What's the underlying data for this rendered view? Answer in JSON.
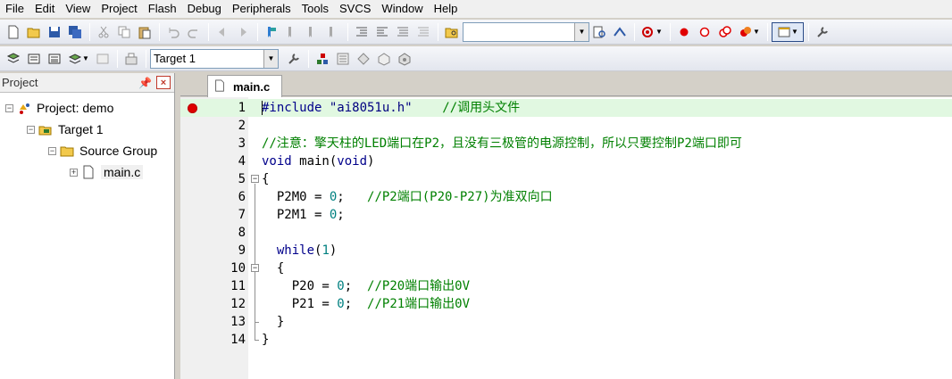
{
  "menu": [
    "File",
    "Edit",
    "View",
    "Project",
    "Flash",
    "Debug",
    "Peripherals",
    "Tools",
    "SVCS",
    "Window",
    "Help"
  ],
  "toolbar2": {
    "target_value": "Target 1"
  },
  "project_panel": {
    "title": "Project",
    "pin_glyph": "📌",
    "close_glyph": "×",
    "tree": {
      "project": "Project: demo",
      "target": "Target 1",
      "group": "Source Group",
      "file": "main.c"
    }
  },
  "editor": {
    "tab_label": "main.c",
    "lines": [
      {
        "n": "1",
        "segments": [
          {
            "t": "#include ",
            "c": "pp"
          },
          {
            "t": "\"ai8051u.h\"",
            "c": "str"
          },
          {
            "t": "    ",
            "c": ""
          },
          {
            "t": "//调用头文件",
            "c": "cmt"
          }
        ]
      },
      {
        "n": "2",
        "segments": []
      },
      {
        "n": "3",
        "segments": [
          {
            "t": "//注意：擎天柱的LED端口在P2，且没有三极管的电源控制，所以只要控制P2端口即可",
            "c": "cmt"
          }
        ]
      },
      {
        "n": "4",
        "segments": [
          {
            "t": "void",
            "c": "kw"
          },
          {
            "t": " main(",
            "c": ""
          },
          {
            "t": "void",
            "c": "kw"
          },
          {
            "t": ")",
            "c": ""
          }
        ]
      },
      {
        "n": "5",
        "segments": [
          {
            "t": "{",
            "c": ""
          }
        ]
      },
      {
        "n": "6",
        "segments": [
          {
            "t": "  P2M0 = ",
            "c": ""
          },
          {
            "t": "0",
            "c": "num"
          },
          {
            "t": ";   ",
            "c": ""
          },
          {
            "t": "//P2端口(P20-P27)为准双向口",
            "c": "cmt"
          }
        ]
      },
      {
        "n": "7",
        "segments": [
          {
            "t": "  P2M1 = ",
            "c": ""
          },
          {
            "t": "0",
            "c": "num"
          },
          {
            "t": ";",
            "c": ""
          }
        ]
      },
      {
        "n": "8",
        "segments": []
      },
      {
        "n": "9",
        "segments": [
          {
            "t": "  ",
            "c": ""
          },
          {
            "t": "while",
            "c": "kw"
          },
          {
            "t": "(",
            "c": ""
          },
          {
            "t": "1",
            "c": "num"
          },
          {
            "t": ")",
            "c": ""
          }
        ]
      },
      {
        "n": "10",
        "segments": [
          {
            "t": "  {",
            "c": ""
          }
        ]
      },
      {
        "n": "11",
        "segments": [
          {
            "t": "    P20 = ",
            "c": ""
          },
          {
            "t": "0",
            "c": "num"
          },
          {
            "t": ";  ",
            "c": ""
          },
          {
            "t": "//P20端口输出0V",
            "c": "cmt"
          }
        ]
      },
      {
        "n": "12",
        "segments": [
          {
            "t": "    P21 = ",
            "c": ""
          },
          {
            "t": "0",
            "c": "num"
          },
          {
            "t": ";  ",
            "c": ""
          },
          {
            "t": "//P21端口输出0V",
            "c": "cmt"
          }
        ]
      },
      {
        "n": "13",
        "segments": [
          {
            "t": "  }",
            "c": ""
          }
        ]
      },
      {
        "n": "14",
        "segments": [
          {
            "t": "}",
            "c": ""
          }
        ]
      }
    ]
  },
  "colors": {
    "highlight_line": "#e1f8e1",
    "keyword": "#00008b",
    "comment": "#008000",
    "number": "#008080",
    "breakpoint": "#e00000"
  }
}
